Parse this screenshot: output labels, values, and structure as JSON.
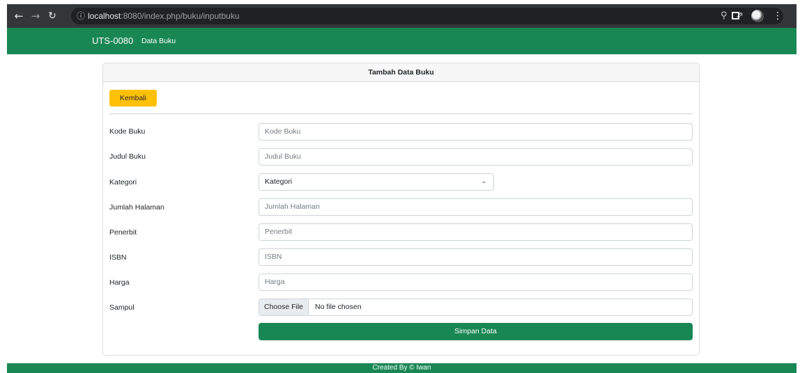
{
  "browser": {
    "url_host": "localhost",
    "url_rest": ":8080/index.php/buku/inputbuku"
  },
  "navbar": {
    "brand": "UTS-0080",
    "link": "Data Buku"
  },
  "card": {
    "title": "Tambah Data Buku",
    "back_label": "Kembali"
  },
  "form": {
    "fields": [
      {
        "label": "Kode Buku",
        "placeholder": "Kode Buku"
      },
      {
        "label": "Judul Buku",
        "placeholder": "Judul Buku"
      },
      {
        "label": "Kategori",
        "selected": "Kategori"
      },
      {
        "label": "Jumlah Halaman",
        "placeholder": "Jumlah Halaman"
      },
      {
        "label": "Penerbit",
        "placeholder": "Penerbit"
      },
      {
        "label": "ISBN",
        "placeholder": "ISBN"
      },
      {
        "label": "Harga",
        "placeholder": "Harga"
      },
      {
        "label": "Sampul",
        "file_button": "Choose File",
        "file_status": "No file chosen"
      }
    ],
    "submit_label": "Simpan Data"
  },
  "footer": {
    "text": "Created By © Iwan"
  },
  "colors": {
    "primary_green": "#198754",
    "warning_yellow": "#ffc107",
    "chrome_dark": "#35363a"
  }
}
